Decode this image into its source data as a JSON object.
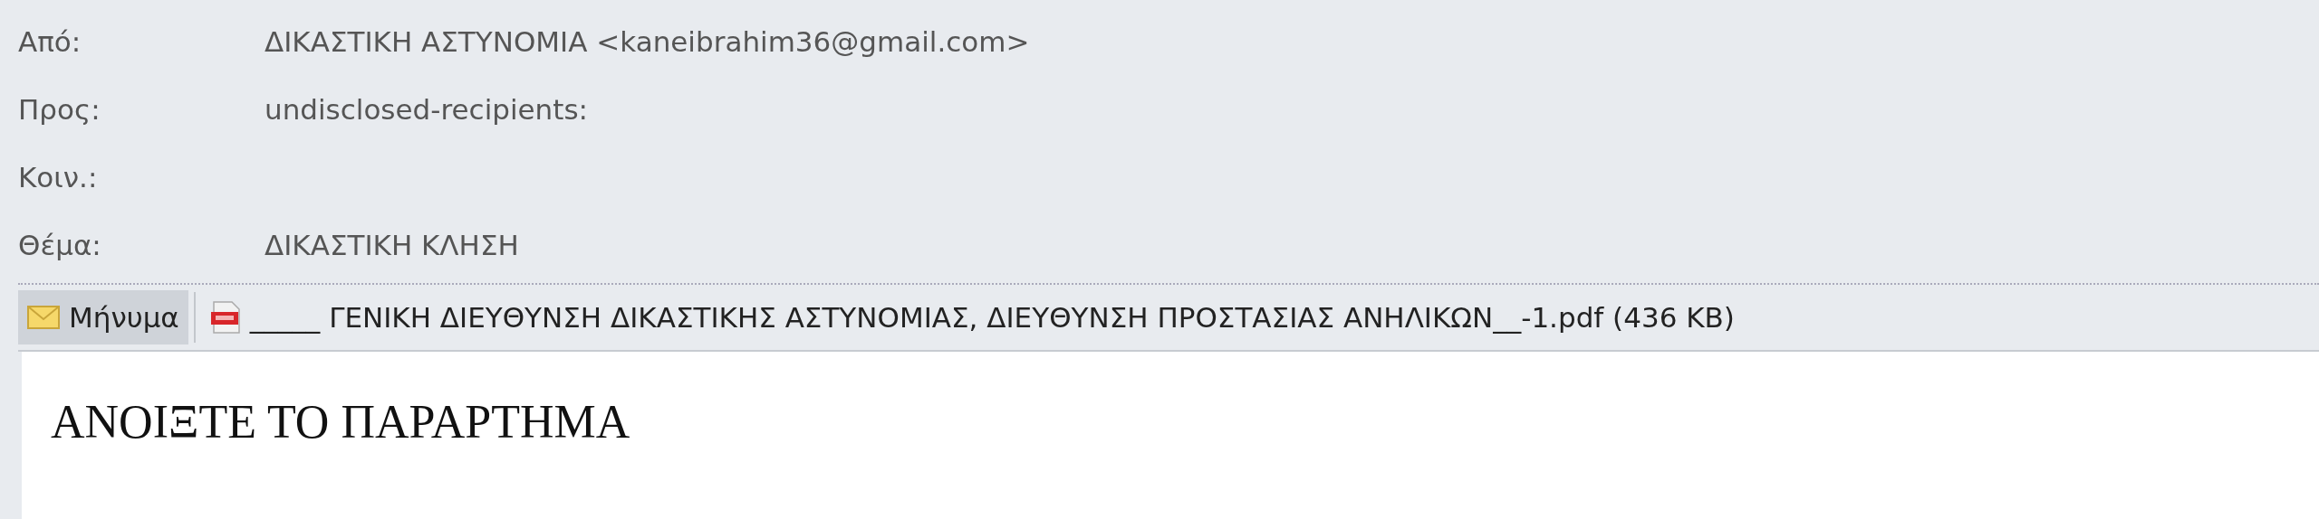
{
  "header_fields": [
    {
      "label": "Από:",
      "value": "ΔΙΚΑΣΤΙΚΗ ΑΣΤΥΝΟΜΙΑ <kaneibrahim36@gmail.com>"
    },
    {
      "label": "Προς:",
      "value": "undisclosed-recipients:"
    },
    {
      "label": "Κοιν.:"
    },
    {
      "label": "Θέμα:",
      "value": "ΔΙΚΑΣΤΙΚΗ ΚΛΗΣΗ"
    }
  ],
  "tabs": [
    {
      "kind": "message",
      "label": "Μήνυμα",
      "selected": true
    },
    {
      "kind": "attachment",
      "label": "_____ ΓΕΝΙΚΗ ΔΙΕΥΘΥΝΣΗ ΔΙΚΑΣΤΙΚΗΣ ΑΣΤΥΝΟΜΙΑΣ, ΔΙΕΥΘΥΝΣΗ ΠΡΟΣΤΑΣΙΑΣ ΑΝΗΛΙΚΩΝ__-1.pdf (436 KB)",
      "selected": false
    }
  ],
  "body": {
    "text": "ΑΝΟΙΞΤΕ ΤΟ ΠΑΡΑΡΤΗΜΑ"
  }
}
